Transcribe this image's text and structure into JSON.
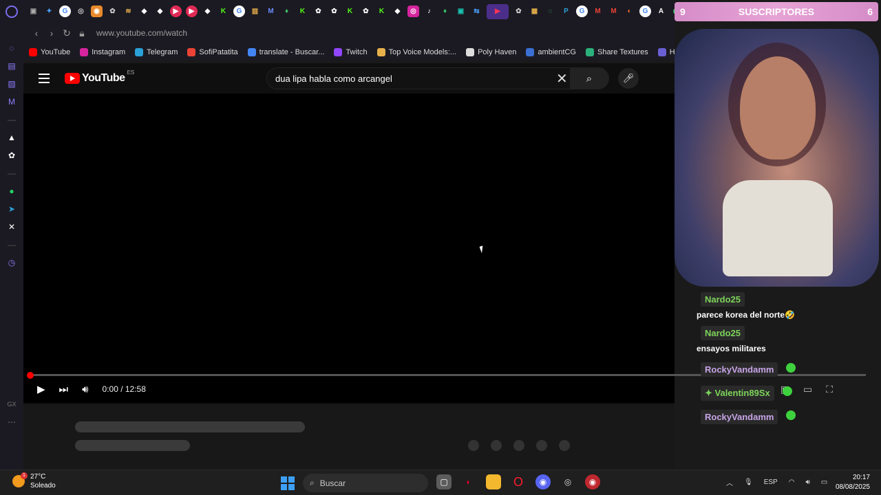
{
  "subs_banner": {
    "left": "9",
    "label": "SUSCRIPTORES",
    "right": "6"
  },
  "browser": {
    "url": "www.youtube.com/watch",
    "bookmarks": [
      {
        "label": "YouTube",
        "color": "#ff0000"
      },
      {
        "label": "Instagram",
        "color": "#d6249f"
      },
      {
        "label": "Telegram",
        "color": "#2aa1d8"
      },
      {
        "label": "SofiPatatita",
        "color": "#ea4335"
      },
      {
        "label": "translate - Buscar...",
        "color": "#4285f4"
      },
      {
        "label": "Twitch",
        "color": "#9146ff"
      },
      {
        "label": "Top Voice Models:...",
        "color": "#e8b04b"
      },
      {
        "label": "Poly Haven",
        "color": "#dddddd"
      },
      {
        "label": "ambientCG",
        "color": "#3b6fd4"
      },
      {
        "label": "Share Textures",
        "color": "#2ab07a"
      },
      {
        "label": "Ha...",
        "color": "#6b5fd6"
      }
    ]
  },
  "youtube": {
    "logo_word": "YouTube",
    "region": "ES",
    "search_query": "dua lipa habla como arcangel",
    "time": "0:00 / 12:58",
    "progress_fraction": 0
  },
  "chat": [
    {
      "user": "Nardo25",
      "text": "parece korea del norte🤣",
      "color": "green"
    },
    {
      "user": "Nardo25",
      "text": "ensayos militares",
      "color": "green"
    },
    {
      "user": "RockyVandamm",
      "text": "",
      "color": "purple"
    },
    {
      "user": "✦ Valentin89Sx",
      "text": "",
      "color": "green"
    },
    {
      "user": "RockyVandamm",
      "text": "",
      "color": "purple"
    }
  ],
  "taskbar": {
    "weather_temp": "27°C",
    "weather_desc": "Soleado",
    "weather_badge": "1",
    "search_label": "Buscar",
    "lang": "ESP",
    "time": "20:17",
    "date": "08/08/2025"
  }
}
